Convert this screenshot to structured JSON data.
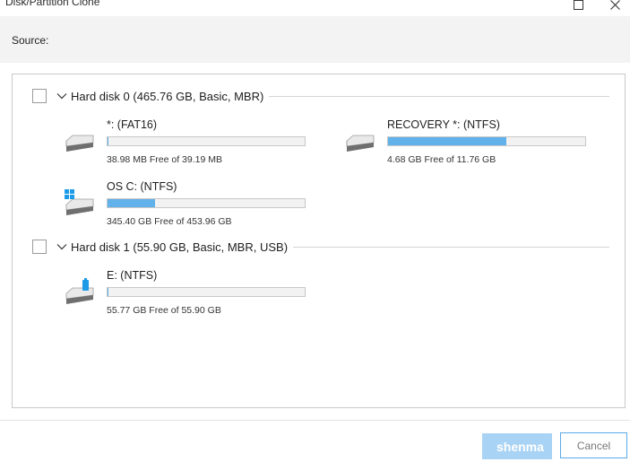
{
  "window": {
    "title": "Disk/Partition Clone",
    "maximize_icon": "maximize-icon",
    "close_icon": "close-icon"
  },
  "source": {
    "label": "Source:"
  },
  "disks": [
    {
      "title": "Hard disk 0 (465.76 GB, Basic, MBR)",
      "checked": false,
      "partitions": [
        {
          "name": "*: (FAT16)",
          "free_text": "38.98 MB Free of 39.19 MB",
          "used_fraction": 0.005,
          "icon": "drive-icon"
        },
        {
          "name": "RECOVERY *: (NTFS)",
          "free_text": "4.68 GB Free of 11.76 GB",
          "used_fraction": 0.602,
          "icon": "drive-icon"
        },
        {
          "name": "OS C: (NTFS)",
          "free_text": "345.40 GB Free of 453.96 GB",
          "used_fraction": 0.239,
          "icon": "windows-drive-icon"
        }
      ]
    },
    {
      "title": "Hard disk 1 (55.90 GB, Basic, MBR, USB)",
      "checked": false,
      "partitions": [
        {
          "name": "E: (NTFS)",
          "free_text": "55.77 GB Free of 55.90 GB",
          "used_fraction": 0.003,
          "icon": "usb-drive-icon"
        }
      ]
    }
  ],
  "footer": {
    "next_label": "shenma",
    "cancel_label": "Cancel"
  },
  "colors": {
    "bar_fill": "#61b1ea",
    "primary_button": "#a9d3f4",
    "cancel_border": "#5aa9e6"
  }
}
